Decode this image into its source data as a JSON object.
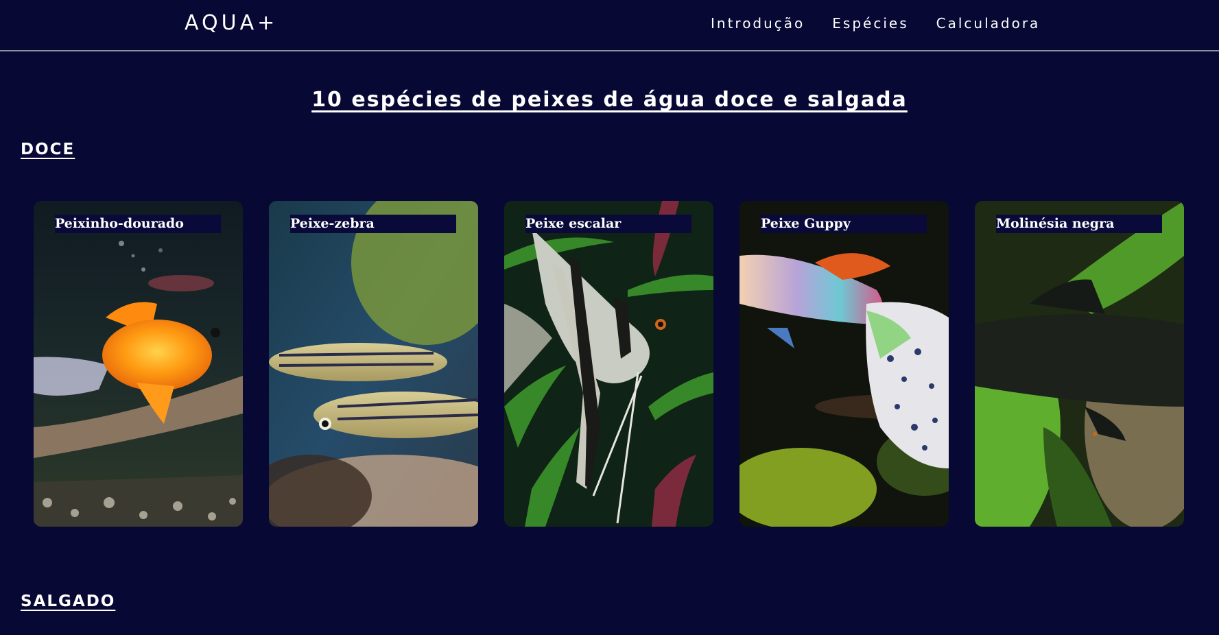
{
  "header": {
    "logo": "AQUA+",
    "nav": [
      "Introdução",
      "Espécies",
      "Calculadora"
    ]
  },
  "main": {
    "title": "10 espécies de peixes de água doce e salgada",
    "sections": [
      "DOCE",
      "SALGADO"
    ],
    "doce_cards": [
      {
        "label": "Peixinho-dourado"
      },
      {
        "label": "Peixe-zebra"
      },
      {
        "label": "Peixe escalar"
      },
      {
        "label": "Peixe Guppy"
      },
      {
        "label": "Molinésia negra"
      }
    ]
  },
  "colors": {
    "background": "#080834",
    "label_bg": "#0a0a3a",
    "text": "#ffffff",
    "divider": "#8e8fa0"
  }
}
